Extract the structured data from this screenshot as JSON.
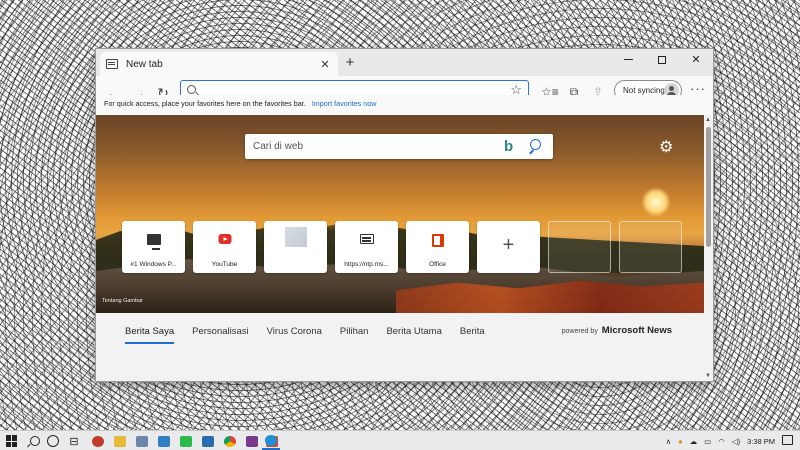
{
  "browser": {
    "tab_title": "New tab",
    "tab_close": "✕",
    "new_tab": "+",
    "window_close": "✕",
    "address_placeholder": "",
    "sync_label": "Not syncing",
    "more": "···",
    "favorites_message": "For quick access, place your favorites here on the favorites bar.",
    "import_link": "Import favorites now"
  },
  "newtab": {
    "search_placeholder": "Cari di web",
    "bing_logo": "b",
    "settings_icon": "gear-icon",
    "image_caption": "Tentang Gambar",
    "tiles": [
      {
        "label": "#1 Windows P...",
        "icon": "monitor-icon"
      },
      {
        "label": "YouTube",
        "icon": "youtube-icon"
      },
      {
        "label": "",
        "icon": "blurred-thumbnail"
      },
      {
        "label": "https://ntp.ms...",
        "icon": "ntp-icon"
      },
      {
        "label": "Office",
        "icon": "office-icon"
      },
      {
        "label": "+",
        "icon": "add-icon"
      }
    ],
    "news_tabs": [
      "Berita Saya",
      "Personalisasi",
      "Virus Corona",
      "Pilihan",
      "Berita Utama",
      "Berita"
    ],
    "active_news_tab": "Berita Saya",
    "powered_by": "powered by",
    "powered_brand": "Microsoft News"
  },
  "taskbar": {
    "clock": "3:38 PM",
    "accent": "#1a6fd0"
  }
}
